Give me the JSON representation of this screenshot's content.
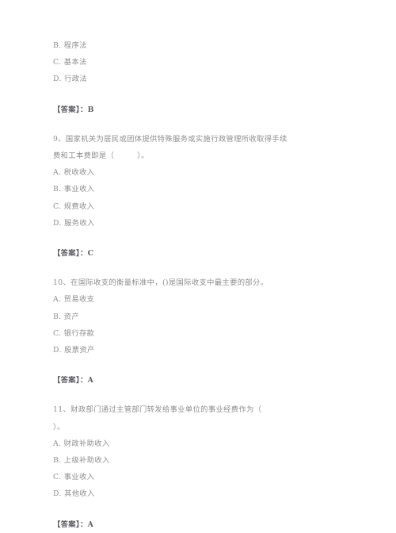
{
  "document": {
    "background_color": "#ffffff",
    "text_color": "#8e8e92",
    "answer_text_color": "#5f5f64",
    "blocks": [
      {
        "type": "options_tail",
        "options": [
          "B. 程序法",
          "C. 基本法",
          "D. 行政法"
        ]
      },
      {
        "type": "answer",
        "text": "【答案】：B"
      },
      {
        "type": "question",
        "stem_lines": [
          "9、国家机关为居民或团体提供特殊服务或实施行政管理所收取得手续",
          "费和工本费即是（　　　）。"
        ],
        "options": [
          "A. 税收收入",
          "B. 事业收入",
          "C. 规费收入",
          "D. 服务收入"
        ]
      },
      {
        "type": "answer",
        "text": "【答案】：C"
      },
      {
        "type": "question",
        "stem_lines": [
          "10、在国际收支的衡量标准中，()是国际收支中最主要的部分。"
        ],
        "options": [
          "A. 贸易收支",
          "B. 资产",
          "C. 银行存款",
          "D. 股票资产"
        ]
      },
      {
        "type": "answer",
        "text": "【答案】：A"
      },
      {
        "type": "question",
        "stem_lines": [
          "11、财政部门通过主管部门转发给事业单位的事业经费作为（",
          "）。"
        ],
        "options": [
          "A. 财政补助收入",
          "B. 上级补助收入",
          "C. 事业收入",
          "D. 其他收入"
        ]
      },
      {
        "type": "answer",
        "text": "【答案】：A"
      }
    ]
  }
}
